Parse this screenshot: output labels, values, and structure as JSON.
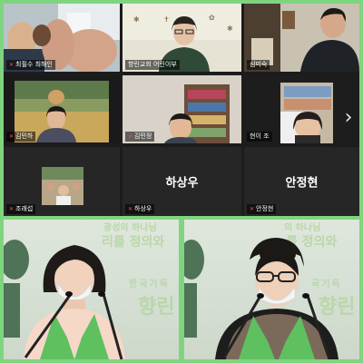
{
  "gallery": {
    "tiles": [
      {
        "name": "최필수 최해인",
        "muted": true
      },
      {
        "name": "향린교회 어린이부",
        "muted": false
      },
      {
        "name": "심미숙",
        "muted": false
      },
      {
        "name": "김민하",
        "muted": true
      },
      {
        "name": "김민정",
        "muted": true
      },
      {
        "name": "현이 조",
        "muted": false
      },
      {
        "name": "조래섭",
        "muted": true
      },
      {
        "name": "하상우",
        "muted": true,
        "video_off": true
      },
      {
        "name": "안정현",
        "muted": true,
        "video_off": true
      }
    ],
    "next_page_icon": "chevron-right-icon"
  },
  "stage": {
    "banner_left_1": "광성의 하나님",
    "banner_left_2": "리를 정의와",
    "banner_left_3": "한국기독",
    "banner_left_4": "향린",
    "banner_right_1": "의 하나님",
    "banner_right_2": "를 정의와",
    "banner_right_3": "국기독",
    "banner_right_4": "향린"
  },
  "colors": {
    "frame": "#7fd57f",
    "active_speaker": "#e7d63f",
    "stole": "#5fc060"
  }
}
